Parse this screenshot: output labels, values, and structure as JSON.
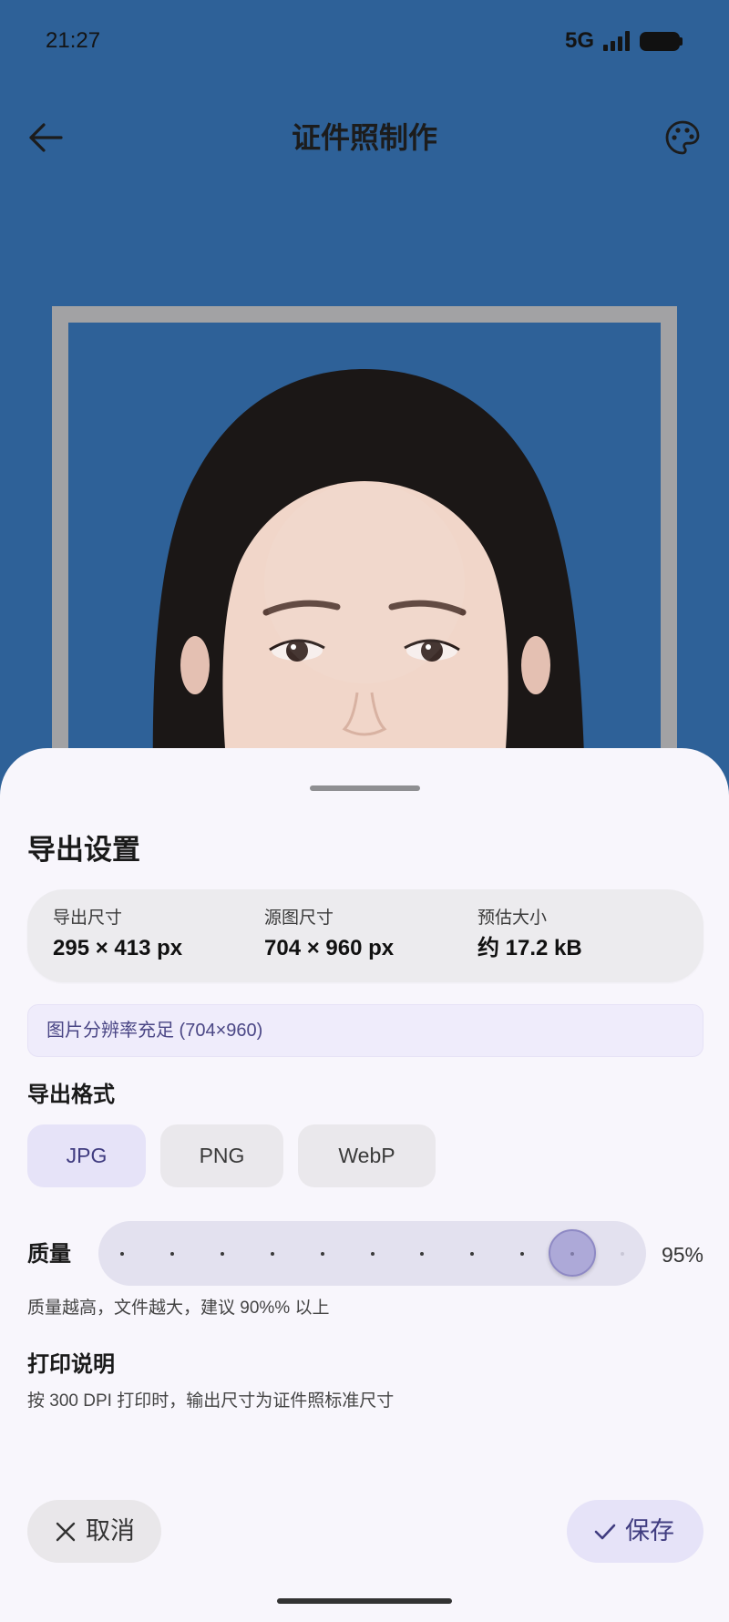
{
  "status_bar": {
    "time": "21:27",
    "network": "5G",
    "signal_icon": "signal-bars-icon",
    "battery_icon": "battery-icon"
  },
  "app_bar": {
    "title": "证件照制作",
    "back_icon": "arrow-back-icon",
    "palette_icon": "palette-icon"
  },
  "export_sheet": {
    "title": "导出设置",
    "stats": [
      {
        "label": "导出尺寸",
        "value": "295 × 413 px"
      },
      {
        "label": "源图尺寸",
        "value": "704 × 960 px"
      },
      {
        "label": "预估大小",
        "value": "约 17.2 kB"
      }
    ],
    "resolution_notice": "图片分辨率充足 (704×960)",
    "format": {
      "heading": "导出格式",
      "options": [
        {
          "label": "JPG",
          "selected": true
        },
        {
          "label": "PNG",
          "selected": false
        },
        {
          "label": "WebP",
          "selected": false
        }
      ]
    },
    "quality": {
      "label": "质量",
      "value": 95,
      "display": "95%",
      "hint": "质量越高，文件越大，建议 90%% 以上"
    },
    "print_info": {
      "heading": "打印说明",
      "text": "按 300 DPI 打印时，输出尺寸为证件照标准尺寸"
    },
    "actions": {
      "cancel_label": "取消",
      "cancel_icon": "close-icon",
      "save_label": "保存",
      "save_icon": "check-icon"
    }
  },
  "colors": {
    "photo_background": "#2e6198",
    "frame": "#a2a2a4",
    "sheet_background": "#f8f6fc",
    "accent": "#403c80",
    "accent_container": "#e6e3f8",
    "chip_background": "#eae8ec"
  }
}
